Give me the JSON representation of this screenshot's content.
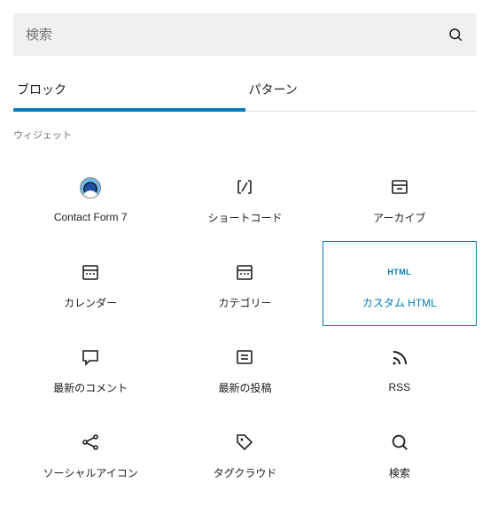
{
  "search": {
    "placeholder": "検索"
  },
  "tabs": {
    "block": "ブロック",
    "pattern": "パターン"
  },
  "section": {
    "widgets": "ウィジェット"
  },
  "blocks": {
    "cf7": "Contact Form 7",
    "shortcode": "ショートコード",
    "archive": "アーカイブ",
    "calendar": "カレンダー",
    "category": "カテゴリー",
    "custom_html": "カスタム HTML",
    "html_badge": "HTML",
    "latest_comments": "最新のコメント",
    "latest_posts": "最新の投稿",
    "rss": "RSS",
    "social_icons": "ソーシャルアイコン",
    "tag_cloud": "タグクラウド",
    "search_block": "検索"
  }
}
